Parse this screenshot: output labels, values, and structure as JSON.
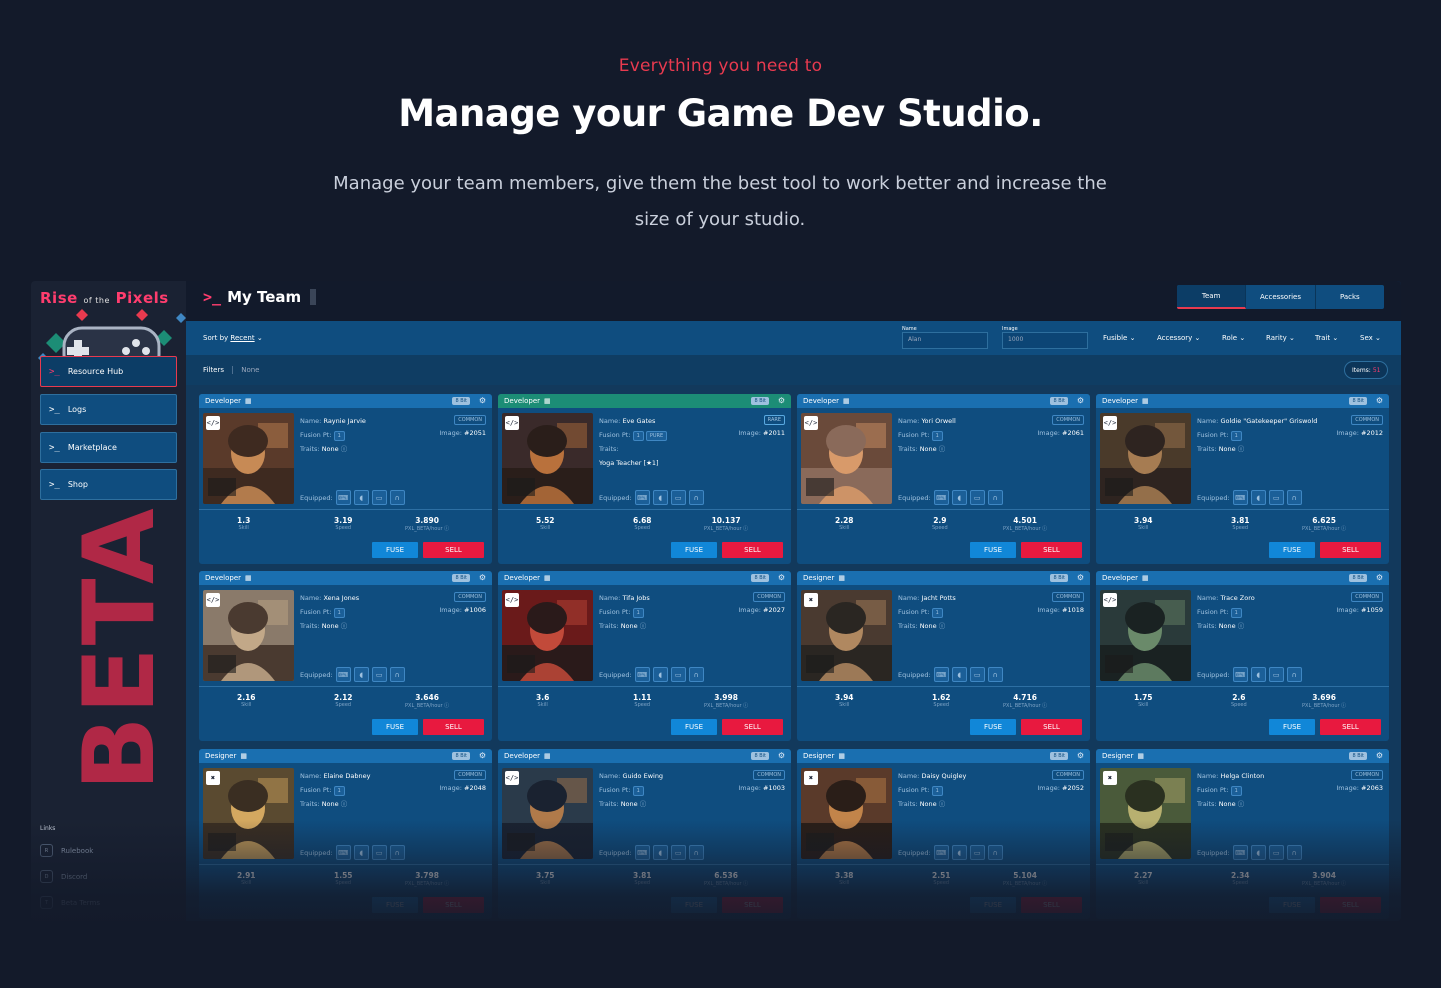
{
  "hero": {
    "eyebrow": "Everything you need to",
    "title": "Manage your Game Dev Studio.",
    "subtitle": "Manage your team members, give them the best tool to work better and increase the size of your studio."
  },
  "sidebar": {
    "logo": {
      "part1": "Rise",
      "part2": "of the",
      "part3": "Pixels"
    },
    "beta": "BETA",
    "items": [
      {
        "label": "Resource Hub",
        "icon": "terminal-prompt-icon"
      },
      {
        "label": "Logs",
        "icon": "terminal-prompt-icon"
      },
      {
        "label": "Marketplace",
        "icon": "terminal-prompt-icon"
      },
      {
        "label": "Shop",
        "icon": "terminal-prompt-icon"
      }
    ],
    "links_title": "Links",
    "links": [
      {
        "label": "Rulebook",
        "icon": "R"
      },
      {
        "label": "Discord",
        "icon": "D"
      },
      {
        "label": "Beta Terms",
        "icon": "T"
      }
    ]
  },
  "main": {
    "title": "My Team",
    "tabs": [
      "Team",
      "Accessories",
      "Packs"
    ],
    "sort_label": "Sort by",
    "sort_value": "Recent",
    "name_label": "Name",
    "name_placeholder": "Alan",
    "image_label": "Image",
    "image_placeholder": "1000",
    "dropdowns": [
      "Fusible",
      "Accessory",
      "Role",
      "Rarity",
      "Trait",
      "Sex"
    ],
    "filters_label": "Filters",
    "filters_value": "None",
    "items_label": "Items:",
    "items_count": "51"
  },
  "labels": {
    "name": "Name:",
    "fusion": "Fusion Pt:",
    "traits": "Traits:",
    "image": "Image:",
    "equipped": "Equipped:",
    "skill": "Skill",
    "speed": "Speed",
    "rate": "PXL_BETA/hour",
    "fuse": "FUSE",
    "sell": "SELL",
    "bit": "8 Bit"
  },
  "cards": [
    {
      "role": "Developer",
      "name": "Raynie Jarvie",
      "fusion": "1",
      "extra": "",
      "traits": "None",
      "rarity": "COMMON",
      "image": "#2051",
      "skill": "1.3",
      "speed": "3.19",
      "rate": "3.890",
      "palette": [
        "#5a3a2a",
        "#c78a55",
        "#3e2a20"
      ]
    },
    {
      "role": "Developer",
      "name": "Eve Gates",
      "fusion": "1",
      "extra": "PURE",
      "traits": "",
      "trait_item": "Yoga Teacher [★1]",
      "rarity": "RARE",
      "image": "#2011",
      "skill": "5.52",
      "speed": "6.68",
      "rate": "10.137",
      "palette": [
        "#3a2a2a",
        "#b9713c",
        "#2a1e1a"
      ]
    },
    {
      "role": "Developer",
      "name": "Yori Orwell",
      "fusion": "1",
      "extra": "",
      "traits": "None",
      "rarity": "COMMON",
      "image": "#2061",
      "skill": "2.28",
      "speed": "2.9",
      "rate": "4.501",
      "palette": [
        "#6a4a3a",
        "#d89a6a",
        "#8a6a5a"
      ]
    },
    {
      "role": "Developer",
      "name": "Goldie \"Gatekeeper\" Griswold",
      "fusion": "1",
      "extra": "",
      "traits": "None",
      "rarity": "COMMON",
      "image": "#2012",
      "skill": "3.94",
      "speed": "3.81",
      "rate": "6.625",
      "palette": [
        "#4a3a2a",
        "#a67c52",
        "#2e2420"
      ]
    },
    {
      "role": "Developer",
      "name": "Xena Jones",
      "fusion": "1",
      "extra": "",
      "traits": "None",
      "rarity": "COMMON",
      "image": "#1006",
      "skill": "2.16",
      "speed": "2.12",
      "rate": "3.646",
      "palette": [
        "#8a7a6a",
        "#c2a888",
        "#4a3a30"
      ]
    },
    {
      "role": "Developer",
      "name": "Tifa Jobs",
      "fusion": "1",
      "extra": "",
      "traits": "None",
      "rarity": "COMMON",
      "image": "#2027",
      "skill": "3.6",
      "speed": "1.11",
      "rate": "3.998",
      "palette": [
        "#6a1a1a",
        "#c24a3a",
        "#2a1a1a"
      ]
    },
    {
      "role": "Designer",
      "name": "Jacht Potts",
      "fusion": "1",
      "extra": "",
      "traits": "None",
      "rarity": "COMMON",
      "image": "#1018",
      "skill": "3.94",
      "speed": "1.62",
      "rate": "4.716",
      "palette": [
        "#4a3a30",
        "#b08860",
        "#2a2622"
      ]
    },
    {
      "role": "Developer",
      "name": "Trace Zoro",
      "fusion": "1",
      "extra": "",
      "traits": "None",
      "rarity": "COMMON",
      "image": "#1059",
      "skill": "1.75",
      "speed": "2.6",
      "rate": "3.696",
      "palette": [
        "#2a3a3a",
        "#6a8a6a",
        "#1a2222"
      ]
    },
    {
      "role": "Designer",
      "name": "Elaine Dabney",
      "fusion": "1",
      "extra": "",
      "traits": "None",
      "rarity": "COMMON",
      "image": "#2048",
      "skill": "2.91",
      "speed": "1.55",
      "rate": "3.798",
      "palette": [
        "#5a4a30",
        "#d4a860",
        "#3a2e22"
      ]
    },
    {
      "role": "Developer",
      "name": "Guido Ewing",
      "fusion": "1",
      "extra": "",
      "traits": "None",
      "rarity": "COMMON",
      "image": "#1003",
      "skill": "3.75",
      "speed": "3.81",
      "rate": "6.536",
      "palette": [
        "#2a3a4a",
        "#b07a4a",
        "#1a2230"
      ]
    },
    {
      "role": "Designer",
      "name": "Daisy Quigley",
      "fusion": "1",
      "extra": "",
      "traits": "None",
      "rarity": "COMMON",
      "image": "#2052",
      "skill": "3.38",
      "speed": "2.51",
      "rate": "5.104",
      "palette": [
        "#5a3a2a",
        "#c2844a",
        "#2a1e18"
      ]
    },
    {
      "role": "Designer",
      "name": "Helga Clinton",
      "fusion": "1",
      "extra": "",
      "traits": "None",
      "rarity": "COMMON",
      "image": "#2063",
      "skill": "2.27",
      "speed": "2.34",
      "rate": "3.904",
      "palette": [
        "#4a5a3a",
        "#b8b070",
        "#2a3020"
      ]
    }
  ]
}
